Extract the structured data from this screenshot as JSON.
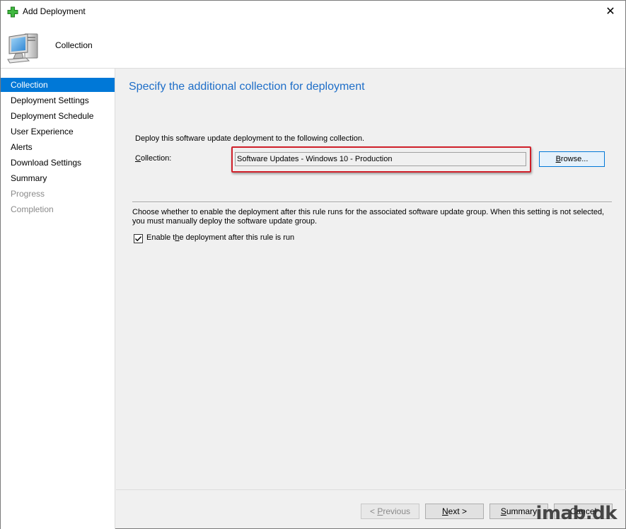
{
  "window": {
    "title": "Add Deployment",
    "close_glyph": "✕"
  },
  "header": {
    "title": "Collection",
    "icon": "computer-icon"
  },
  "nav": {
    "items": [
      {
        "label": "Collection",
        "state": "active"
      },
      {
        "label": "Deployment Settings",
        "state": "normal"
      },
      {
        "label": "Deployment Schedule",
        "state": "normal"
      },
      {
        "label": "User Experience",
        "state": "normal"
      },
      {
        "label": "Alerts",
        "state": "normal"
      },
      {
        "label": "Download Settings",
        "state": "normal"
      },
      {
        "label": "Summary",
        "state": "normal"
      },
      {
        "label": "Progress",
        "state": "disabled"
      },
      {
        "label": "Completion",
        "state": "disabled"
      }
    ]
  },
  "main": {
    "heading": "Specify the additional collection for deployment",
    "deploy_text": "Deploy this software update deployment to the following collection.",
    "collection_label_pre": "C",
    "collection_label_rest": "ollection:",
    "collection_value": "Software Updates - Windows 10 - Production",
    "browse_pre": "B",
    "browse_rest": "rowse...",
    "choose_text": "Choose whether to enable the deployment after this rule runs for the associated software update group. When this setting is not selected, you must manually deploy the software update group.",
    "checkbox_pre": "Enable t",
    "checkbox_u": "h",
    "checkbox_rest": "e deployment after this rule is run",
    "checkbox_checked": true
  },
  "footer": {
    "previous_pre": "< ",
    "previous_u": "P",
    "previous_rest": "revious",
    "next_u": "N",
    "next_rest": "ext >",
    "summary_u": "S",
    "summary_rest": "ummary",
    "cancel": "Cancel"
  },
  "watermark": "imab.dk",
  "colors": {
    "accent": "#0078d7",
    "heading": "#1e6ec8",
    "highlight": "#d0202a"
  }
}
